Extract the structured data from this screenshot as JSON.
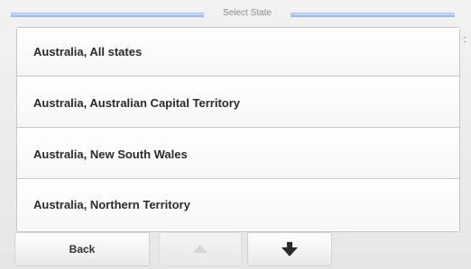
{
  "header": {
    "title": "Select State"
  },
  "list": {
    "items": [
      {
        "label": "Australia, All states"
      },
      {
        "label": "Australia, Australian Capital Territory"
      },
      {
        "label": "Australia, New South Wales"
      },
      {
        "label": "Australia, Northern Territory"
      }
    ]
  },
  "scrollbar": {
    "indicator": ":"
  },
  "footer": {
    "back_label": "Back",
    "up_icon": "arrow-up-icon",
    "down_icon": "arrow-down-icon"
  },
  "colors": {
    "accent": "#8fb0e6",
    "item_text": "#2b2b2b",
    "border": "#c8c8c8"
  }
}
